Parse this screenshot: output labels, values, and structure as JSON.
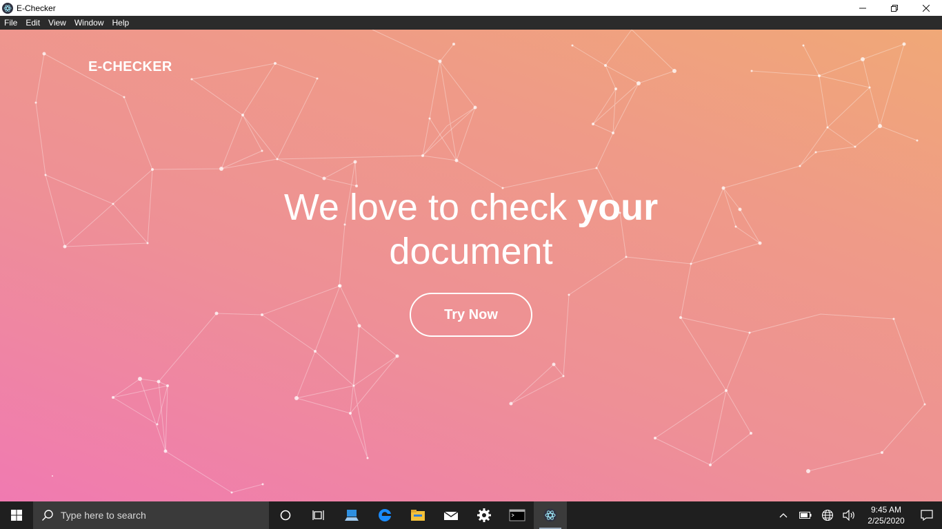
{
  "window": {
    "title": "E-Checker"
  },
  "menu": [
    "File",
    "Edit",
    "View",
    "Window",
    "Help"
  ],
  "page": {
    "brand": "E-CHECKER",
    "headline_part1": "We love to check ",
    "headline_em": "your",
    "headline_part2": "document",
    "cta_label": "Try Now"
  },
  "colors": {
    "gradient_start": "#f07ab1",
    "gradient_end": "#f0a877",
    "text": "#ffffff",
    "taskbar": "#1f1f1f"
  },
  "taskbar": {
    "search_placeholder": "Type here to search",
    "pinned": [
      "cortana-icon",
      "task-view-icon",
      "device-icon",
      "edge-icon",
      "file-explorer-icon",
      "mail-icon",
      "settings-icon",
      "terminal-icon",
      "electron-app-icon"
    ],
    "clock_time": "9:45 AM",
    "clock_date": "2/25/2020"
  }
}
